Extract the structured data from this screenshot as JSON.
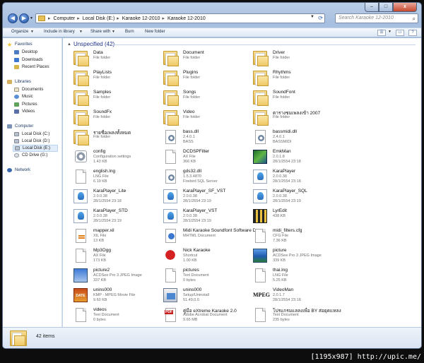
{
  "window": {
    "address": {
      "crumbs": [
        "Computer",
        "Local Disk (E:)",
        "Karaoke 12-2010",
        "Karaoke 12-2010"
      ],
      "separator": "▸"
    },
    "search_placeholder": "Search Karaoke 12-2010",
    "controls": {
      "minimize": "–",
      "maximize": "□",
      "close": "x"
    }
  },
  "toolbar": {
    "organize": "Organize",
    "include": "Include in library",
    "share": "Share with",
    "burn": "Burn",
    "new_folder": "New folder"
  },
  "navigation": {
    "favorites": {
      "label": "Favorites",
      "items": [
        "Desktop",
        "Downloads",
        "Recent Places"
      ]
    },
    "libraries": {
      "label": "Libraries",
      "items": [
        "Documents",
        "Music",
        "Pictures",
        "Videos"
      ]
    },
    "computer": {
      "label": "Computer",
      "items": [
        "Local Disk (C:)",
        "Local Disk (D:)",
        "Local Disk (E:)",
        "CD Drive (G:)"
      ],
      "selected": 2
    },
    "network": {
      "label": "Network"
    }
  },
  "group": {
    "title": "Unspecified (42)"
  },
  "files": [
    {
      "name": "Data",
      "l2": "File folder",
      "l3": "",
      "icon": "folder"
    },
    {
      "name": "Document",
      "l2": "File folder",
      "l3": "",
      "icon": "folder"
    },
    {
      "name": "Driver",
      "l2": "File folder",
      "l3": "",
      "icon": "folder"
    },
    {
      "name": "PlayLists",
      "l2": "File folder",
      "l3": "",
      "icon": "folder"
    },
    {
      "name": "Plugins",
      "l2": "File folder",
      "l3": "",
      "icon": "folder"
    },
    {
      "name": "Rhythms",
      "l2": "File folder",
      "l3": "",
      "icon": "folder"
    },
    {
      "name": "Samples",
      "l2": "File folder",
      "l3": "",
      "icon": "folder"
    },
    {
      "name": "Songs",
      "l2": "File folder",
      "l3": "",
      "icon": "folder"
    },
    {
      "name": "SoundFont",
      "l2": "File folder",
      "l3": "",
      "icon": "folder"
    },
    {
      "name": "SoundFx",
      "l2": "File folder",
      "l3": "",
      "icon": "folder"
    },
    {
      "name": "Video",
      "l2": "File folder",
      "l3": "",
      "icon": "folder"
    },
    {
      "name": "ตารางชมเพลงเข้า 2007",
      "l2": "File folder",
      "l3": "",
      "icon": "folder"
    },
    {
      "name": "รายชื่อเพลงทั้งหมด",
      "l2": "File folder",
      "l3": "",
      "icon": "folder"
    },
    {
      "name": "bass.dll",
      "l2": "2.4.0.1",
      "l3": "BASS",
      "icon": "dll"
    },
    {
      "name": "bassmidi.dll",
      "l2": "2.4.0.1",
      "l3": "BASSMIDI",
      "icon": "dll"
    },
    {
      "name": "config",
      "l2": "Configuration settings",
      "l3": "1.43 KB",
      "icon": "gear"
    },
    {
      "name": "DCDSPFilter",
      "l2": "AX File",
      "l3": "366 KB",
      "icon": "file"
    },
    {
      "name": "EmkMan",
      "l2": "2.0.1.8",
      "l3": "28/1/2554 23:18",
      "icon": "app-emk"
    },
    {
      "name": "english.lng",
      "l2": "LNG File",
      "l3": "6.19 KB",
      "icon": "file"
    },
    {
      "name": "gds32.dll",
      "l2": "1.5.3.4870",
      "l3": "Firebird SQL Server",
      "icon": "dll"
    },
    {
      "name": "KaraPlayer",
      "l2": "2.0.0.38",
      "l3": "28/1/2554 23:18",
      "icon": "app-kara"
    },
    {
      "name": "KaraPlayer_Lite",
      "l2": "2.0.0.38",
      "l3": "28/1/2554 23:18",
      "icon": "app-kara"
    },
    {
      "name": "KaraPlayer_SF_VST",
      "l2": "2.0.0.38",
      "l3": "28/1/2554 23:19",
      "icon": "app-kara"
    },
    {
      "name": "KaraPlayer_SQL",
      "l2": "2.0.0.38",
      "l3": "28/1/2554 23:19",
      "icon": "app-kara"
    },
    {
      "name": "KaraPlayer_STD",
      "l2": "2.0.0.38",
      "l3": "28/1/2554 23:19",
      "icon": "app-kara"
    },
    {
      "name": "KaraPlayer_VST",
      "l2": "2.0.0.38",
      "l3": "28/1/2554 23:19",
      "icon": "app-kara"
    },
    {
      "name": "LyrEdit",
      "l2": "438 KB",
      "l3": "",
      "icon": "app-lyr"
    },
    {
      "name": "mapper.xil",
      "l2": "XIL File",
      "l3": "13 KB",
      "icon": "xml"
    },
    {
      "name": "Midi Karaoke Soundfont Software Download Game Offline Video Cli...",
      "l2": "MHTML Document",
      "l3": "",
      "icon": "mht"
    },
    {
      "name": "midi_filters.cfg",
      "l2": "CFG File",
      "l3": "7.36 KB",
      "icon": "file"
    },
    {
      "name": "Mp3Ogg",
      "l2": "AX File",
      "l3": "173 KB",
      "icon": "file"
    },
    {
      "name": "Nick Karaoke",
      "l2": "Shortcut",
      "l3": "1.00 KB",
      "icon": "app-nick"
    },
    {
      "name": "picture",
      "l2": "ACDSee Pro 3 JPEG Image",
      "l3": "339 KB",
      "icon": "img-blue"
    },
    {
      "name": "picture2",
      "l2": "ACDSee Pro 3 JPEG Image",
      "l3": "337 KB",
      "icon": "img-pic2"
    },
    {
      "name": "pictures",
      "l2": "Text Document",
      "l3": "0 bytes",
      "icon": "file"
    },
    {
      "name": "thai.lng",
      "l2": "LNG File",
      "l3": "5.25 KB",
      "icon": "file"
    },
    {
      "name": "unins000",
      "l2": "KMP - MPEG Movie File",
      "l3": "9.60 KB",
      "icon": "mpeg"
    },
    {
      "name": "unins000",
      "l2": "Setup/Uninstall",
      "l3": "51.49.0.0",
      "icon": "setup"
    },
    {
      "name": "VideoMan",
      "l2": "2.0.1.7",
      "l3": "28/1/2554 23:18",
      "icon": "mpeg-text"
    },
    {
      "name": "videos",
      "l2": "Text Document",
      "l3": "0 bytes",
      "icon": "file"
    },
    {
      "name": "คู่มือ eXtreme Karaoke 2.0",
      "l2": "Adobe Acrobat Document",
      "l3": "9.65 MB",
      "icon": "pdf"
    },
    {
      "name": "โปรแกรมแลลงเพื่อ BY ส่อยุดเเหลง",
      "l2": "Text Document",
      "l3": "235 bytes",
      "icon": "file"
    }
  ],
  "icon_labels": {
    "mpeg": "DATE",
    "mpeg-text": "MPEG"
  },
  "details": {
    "count": "42 items"
  },
  "watermark": "[1195x987] http://upic.me/"
}
